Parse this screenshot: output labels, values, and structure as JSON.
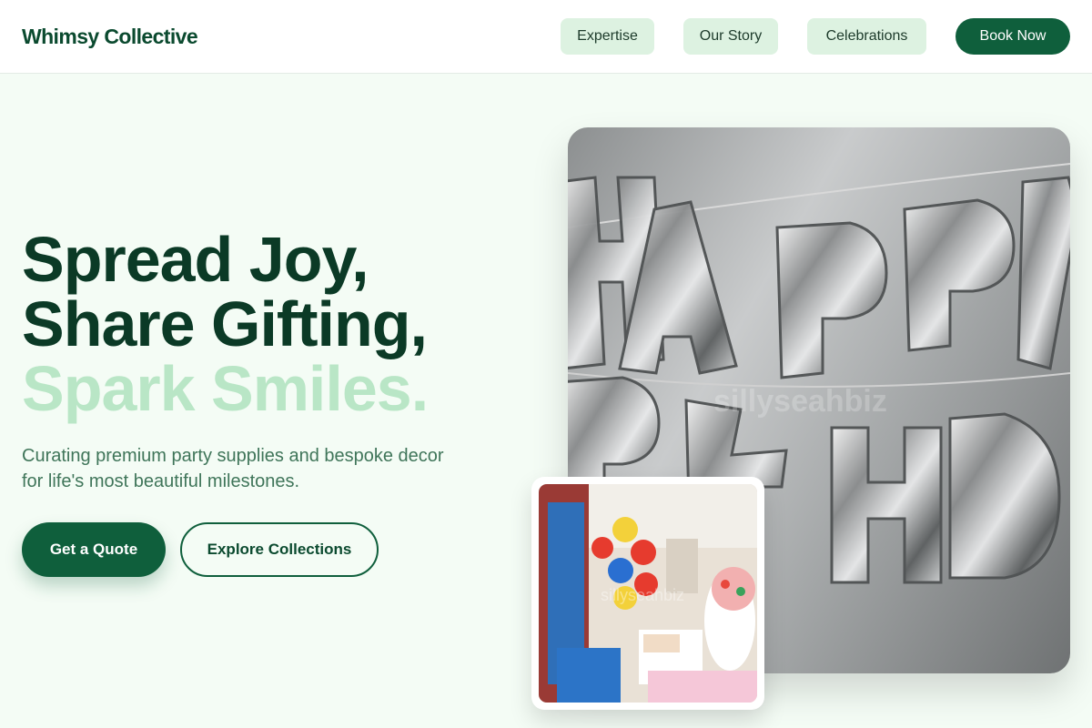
{
  "header": {
    "brand": "Whimsy Collective",
    "nav": [
      "Expertise",
      "Our Story",
      "Celebrations"
    ],
    "cta": "Book Now"
  },
  "hero": {
    "title_line1": "Spread Joy,",
    "title_line2": "Share Gifting,",
    "title_line3": "Spark Smiles.",
    "subtitle": "Curating premium party supplies and bespoke decor for life's most beautiful milestones.",
    "primary_button": "Get a Quote",
    "secondary_button": "Explore Collections"
  },
  "images": {
    "main_watermark": "sillyseahbiz",
    "inset_watermark": "sillyseahbiz"
  },
  "colors": {
    "brand_green": "#0f5f3c",
    "dark_text": "#0b3a26",
    "light_accent": "#b9e6c6",
    "nav_bg": "#ddf2e1",
    "page_bg": "#f4fcf5"
  }
}
